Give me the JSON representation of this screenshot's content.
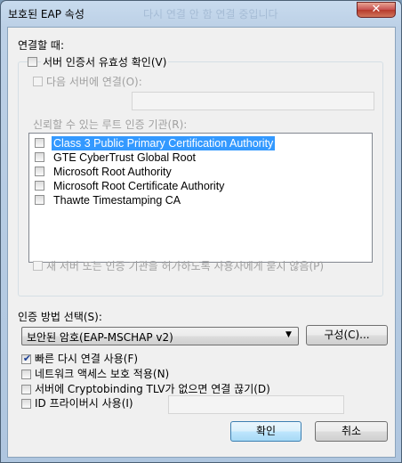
{
  "window": {
    "title": "보호된 EAP 속성",
    "background_ghost_text": "다시 연결 안 함 연결 중입니다"
  },
  "connect": {
    "section_label": "연결할 때:",
    "validate_cert": {
      "label": "서버 인증서 유효성 확인(V)",
      "checked": false
    },
    "connect_to_servers": {
      "label": "다음 서버에 연결(O):",
      "checked": false,
      "value": ""
    },
    "trusted_ca_label": "신뢰할 수 있는 루트 인증 기관(R):",
    "trusted_cas": [
      {
        "label": "Class 3 Public Primary Certification Authority",
        "checked": false,
        "selected": true
      },
      {
        "label": "GTE CyberTrust Global Root",
        "checked": false,
        "selected": false
      },
      {
        "label": "Microsoft Root Authority",
        "checked": false,
        "selected": false
      },
      {
        "label": "Microsoft Root Certificate Authority",
        "checked": false,
        "selected": false
      },
      {
        "label": "Thawte Timestamping CA",
        "checked": false,
        "selected": false
      }
    ],
    "no_prompt": {
      "label": "새 서버 또는 인증 기관을 허가하도록 사용자에게 묻지 않음(P)",
      "checked": false
    }
  },
  "auth": {
    "method_label": "인증 방법 선택(S):",
    "method_value": "보안된 암호(EAP-MSCHAP v2)",
    "configure_label": "구성(C)..."
  },
  "options": [
    {
      "label": "빠른 다시 연결 사용(F)",
      "checked": true
    },
    {
      "label": "네트워크 액세스 보호 적용(N)",
      "checked": false
    },
    {
      "label": "서버에 Cryptobinding TLV가 없으면 연결 끊기(D)",
      "checked": false
    },
    {
      "label": "ID 프라이버시 사용(I)",
      "checked": false
    }
  ],
  "identity_privacy_value": "",
  "buttons": {
    "ok": "확인",
    "cancel": "취소"
  },
  "colors": {
    "selection": "#3399ff",
    "close_button": "#c75050",
    "check_mark": "#1c3f94"
  }
}
